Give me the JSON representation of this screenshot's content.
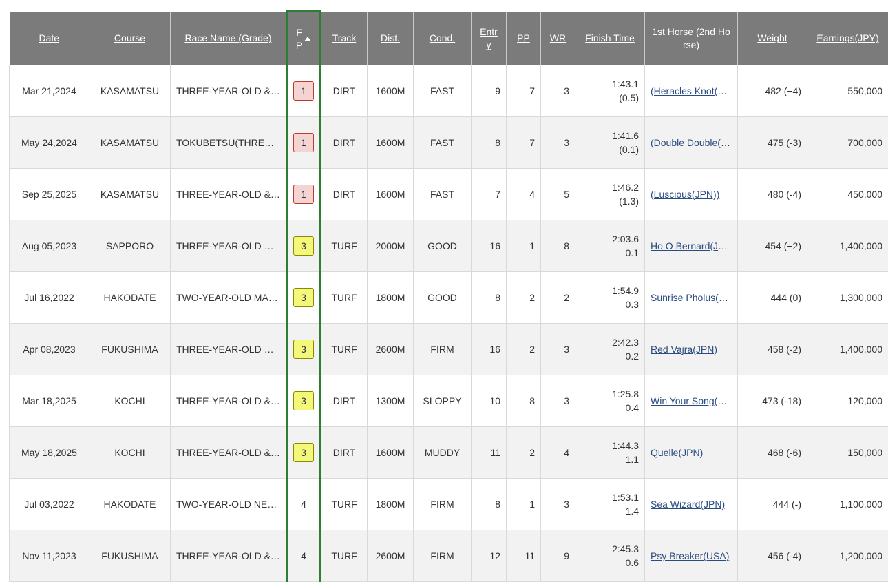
{
  "headers": {
    "date": "Date",
    "course": "Course",
    "race": "Race Name (Grade)",
    "fp_line1": "F",
    "fp_line2": "P",
    "track": "Track",
    "dist": "Dist.",
    "cond": "Cond.",
    "entry_line1": "Entr",
    "entry_line2": "y",
    "pp": "PP",
    "wr": "WR",
    "finish": "Finish Time",
    "first_horse": "1st Horse (2nd Ho rse)",
    "weight": "Weight",
    "earnings": "Earnings(JPY)"
  },
  "rows": [
    {
      "date": "Mar 21,2024",
      "course": "KASAMATSU",
      "race": "THREE-YEAR-OLD & UP",
      "fp": "1",
      "track": "DIRT",
      "dist": "1600M",
      "cond": "FAST",
      "entry": "9",
      "pp": "7",
      "wr": "3",
      "time": "1:43.1",
      "margin": "(0.5)",
      "horse": "(Heracles Knot(JPN))",
      "weight": "482 (+4)",
      "earn": "550,000"
    },
    {
      "date": "May 24,2024",
      "course": "KASAMATSU",
      "race": "TOKUBETSU(THREE-YEAR-OLD & UP)",
      "fp": "1",
      "track": "DIRT",
      "dist": "1600M",
      "cond": "FAST",
      "entry": "8",
      "pp": "7",
      "wr": "3",
      "time": "1:41.6",
      "margin": "(0.1)",
      "horse": "(Double Double(JPN))",
      "weight": "475 (-3)",
      "earn": "700,000"
    },
    {
      "date": "Sep 25,2025",
      "course": "KASAMATSU",
      "race": "THREE-YEAR-OLD & UP",
      "fp": "1",
      "track": "DIRT",
      "dist": "1600M",
      "cond": "FAST",
      "entry": "7",
      "pp": "4",
      "wr": "5",
      "time": "1:46.2",
      "margin": "(1.3)",
      "horse": "(Luscious(JPN))",
      "weight": "480 (-4)",
      "earn": "450,000"
    },
    {
      "date": "Aug 05,2023",
      "course": "SAPPORO",
      "race": "THREE-YEAR-OLD MAIDEN",
      "fp": "3",
      "track": "TURF",
      "dist": "2000M",
      "cond": "GOOD",
      "entry": "16",
      "pp": "1",
      "wr": "8",
      "time": "2:03.6",
      "margin": "0.1",
      "horse": "Ho O Bernard(JPN)",
      "weight": "454 (+2)",
      "earn": "1,400,000"
    },
    {
      "date": "Jul 16,2022",
      "course": "HAKODATE",
      "race": "TWO-YEAR-OLD MAIDEN",
      "fp": "3",
      "track": "TURF",
      "dist": "1800M",
      "cond": "GOOD",
      "entry": "8",
      "pp": "2",
      "wr": "2",
      "time": "1:54.9",
      "margin": "0.3",
      "horse": "Sunrise Pholus(JPN)",
      "weight": "444 (0)",
      "earn": "1,300,000"
    },
    {
      "date": "Apr 08,2023",
      "course": "FUKUSHIMA",
      "race": "THREE-YEAR-OLD MAIDEN",
      "fp": "3",
      "track": "TURF",
      "dist": "2600M",
      "cond": "FIRM",
      "entry": "16",
      "pp": "2",
      "wr": "3",
      "time": "2:42.3",
      "margin": "0.2",
      "horse": "Red Vajra(JPN)",
      "weight": "458 (-2)",
      "earn": "1,400,000"
    },
    {
      "date": "Mar 18,2025",
      "course": "KOCHI",
      "race": "THREE-YEAR-OLD & UP",
      "fp": "3",
      "track": "DIRT",
      "dist": "1300M",
      "cond": "SLOPPY",
      "entry": "10",
      "pp": "8",
      "wr": "3",
      "time": "1:25.8",
      "margin": "0.4",
      "horse": "Win Your Song(JPN)",
      "weight": "473 (-18)",
      "earn": "120,000"
    },
    {
      "date": "May 18,2025",
      "course": "KOCHI",
      "race": "THREE-YEAR-OLD & UP",
      "fp": "3",
      "track": "DIRT",
      "dist": "1600M",
      "cond": "MUDDY",
      "entry": "11",
      "pp": "2",
      "wr": "4",
      "time": "1:44.3",
      "margin": "1.1",
      "horse": "Quelle(JPN)",
      "weight": "468 (-6)",
      "earn": "150,000"
    },
    {
      "date": "Jul 03,2022",
      "course": "HAKODATE",
      "race": "TWO-YEAR-OLD NEWCOMER",
      "fp": "4",
      "track": "TURF",
      "dist": "1800M",
      "cond": "FIRM",
      "entry": "8",
      "pp": "1",
      "wr": "3",
      "time": "1:53.1",
      "margin": "1.4",
      "horse": "Sea Wizard(JPN)",
      "weight": "444 (-)",
      "earn": "1,100,000"
    },
    {
      "date": "Nov 11,2023",
      "course": "FUKUSHIMA",
      "race": "THREE-YEAR-OLD & UP",
      "fp": "4",
      "track": "TURF",
      "dist": "2600M",
      "cond": "FIRM",
      "entry": "12",
      "pp": "11",
      "wr": "9",
      "time": "2:45.3",
      "margin": "0.6",
      "horse": "Psy Breaker(USA)",
      "weight": "456 (-4)",
      "earn": "1,200,000"
    }
  ]
}
